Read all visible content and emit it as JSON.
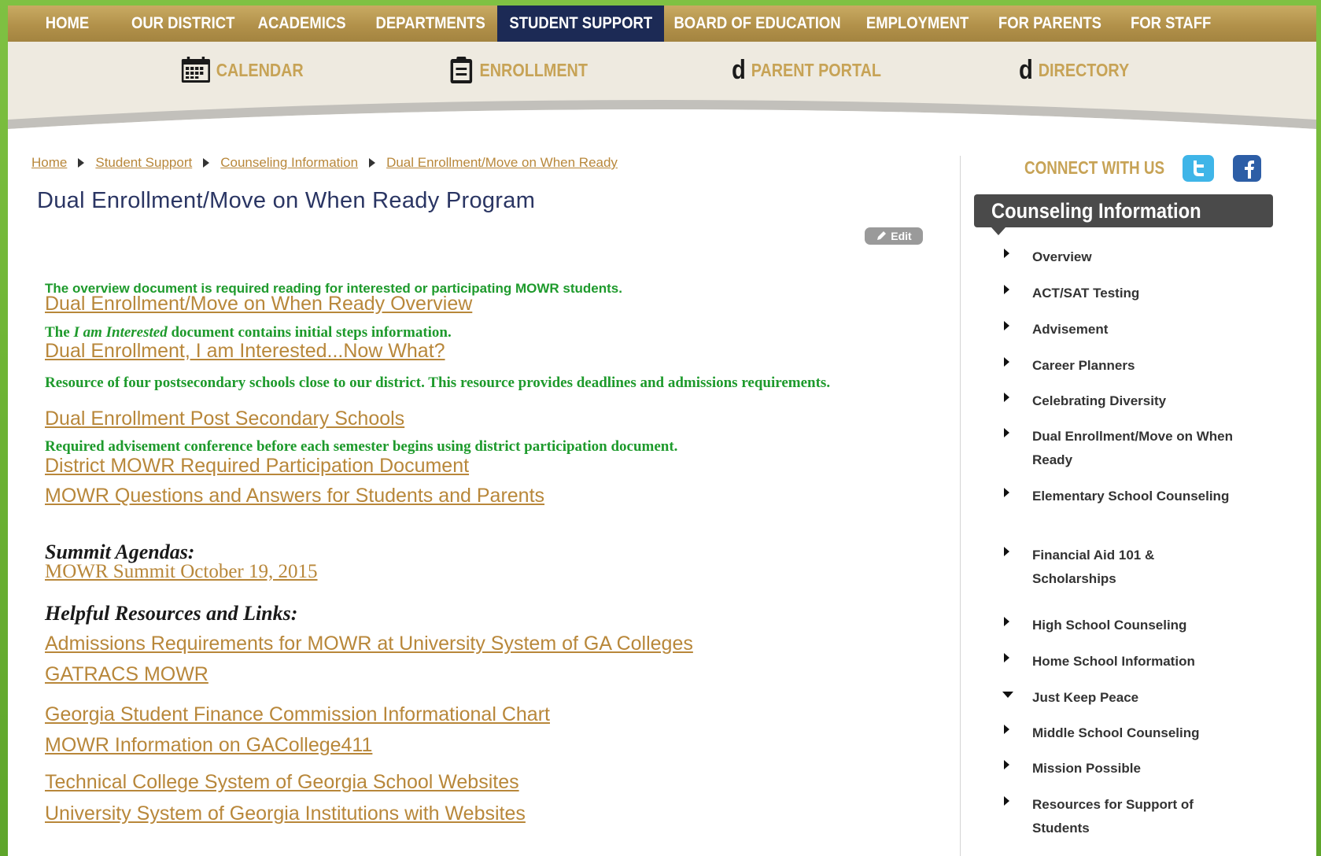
{
  "topnav": {
    "items": [
      {
        "label": "HOME"
      },
      {
        "label": "OUR DISTRICT"
      },
      {
        "label": "ACADEMICS"
      },
      {
        "label": "DEPARTMENTS"
      },
      {
        "label": "STUDENT SUPPORT",
        "active": true
      },
      {
        "label": "BOARD OF EDUCATION"
      },
      {
        "label": "EMPLOYMENT"
      },
      {
        "label": "FOR PARENTS"
      },
      {
        "label": "FOR STAFF"
      }
    ]
  },
  "quicklinks": {
    "calendar": "CALENDAR",
    "enrollment": "ENROLLMENT",
    "parent_portal_glyph": "d",
    "parent_portal": "PARENT PORTAL",
    "directory_glyph": "d",
    "directory": "DIRECTORY"
  },
  "breadcrumb": [
    "Home",
    "Student Support",
    "Counseling Information",
    "Dual Enrollment/Move on When Ready"
  ],
  "page": {
    "title": "Dual Enrollment/Move on When Ready Program",
    "edit_label": "Edit"
  },
  "content": {
    "note1": "The overview document is required reading for interested or participating MOWR students.",
    "link1": "Dual Enrollment/Move on When Ready Overview",
    "note2_prefix": "The",
    "note2_italic": "I am Interested",
    "note2_suffix": "document contains initial steps information.",
    "link2": "Dual Enrollment, I am Interested...Now What?",
    "note3": "Resource of four postsecondary schools close to our district. This resource provides deadlines and admissions requirements.",
    "link3": "Dual Enrollment Post Secondary Schools",
    "note4": "Required advisement conference before each semester begins using district participation document.",
    "link4": "District MOWR Required Participation Document",
    "link5": "MOWR Questions and Answers for Students and Parents",
    "summit_heading": "Summit Agendas:",
    "summit_link": "MOWR Summit October 19, 2015",
    "helpful_heading": "Helpful Resources and Links:",
    "helpful_links": [
      "Admissions Requirements for MOWR at University System of GA Colleges",
      "GATRACS MOWR",
      "Georgia Student Finance Commission Informational Chart",
      "MOWR Information on GACollege411",
      "Technical College System of Georgia School Websites",
      "University System of Georgia Institutions with Websites"
    ]
  },
  "sidebar": {
    "connect": "CONNECT WITH US",
    "heading": "Counseling Information",
    "items": [
      {
        "label": "Overview"
      },
      {
        "label": "ACT/SAT Testing"
      },
      {
        "label": "Advisement"
      },
      {
        "label": "Career Planners"
      },
      {
        "label": "Celebrating Diversity"
      },
      {
        "label": "Dual Enrollment/Move on When Ready"
      },
      {
        "label": "Elementary School Counseling"
      },
      {
        "label": "Financial Aid 101 & Scholarships"
      },
      {
        "label": "High School Counseling"
      },
      {
        "label": "Home School Information"
      },
      {
        "label": "Just Keep Peace",
        "expanded": true
      },
      {
        "label": "Middle School Counseling"
      },
      {
        "label": "Mission Possible"
      },
      {
        "label": "Resources for Support of Students"
      }
    ]
  },
  "colors": {
    "nav_gold": "#b2914a",
    "nav_active": "#1c2a55",
    "link_gold": "#b8873a",
    "note_green": "#1e9a2c",
    "title_navy": "#2a3563",
    "sidebar_head": "#4a4a4a",
    "twitter": "#3fb5e8",
    "facebook": "#2d5ea6"
  }
}
